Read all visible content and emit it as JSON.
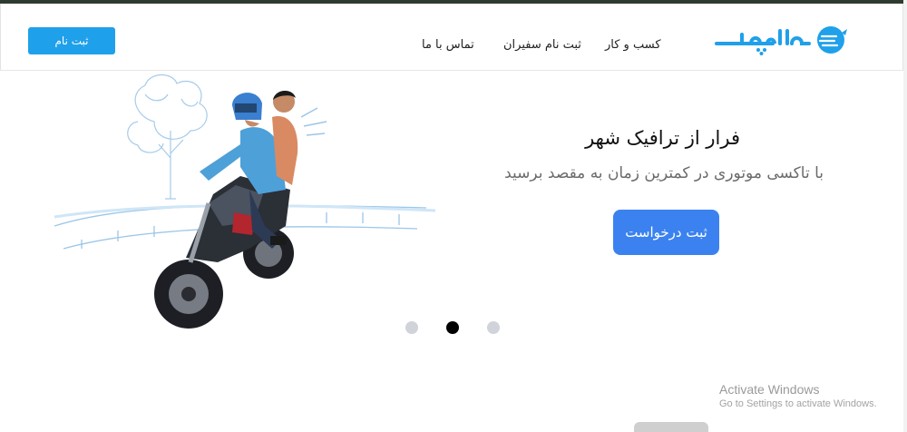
{
  "header": {
    "register_label": "ثبت نام",
    "nav": [
      "کسب و کار",
      "ثبت نام سفیران",
      "تماس با ما"
    ],
    "logo_text": "الوپیک"
  },
  "hero": {
    "title": "فرار از ترافیک شهر",
    "subtitle": "با تاکسی موتوری در کمترین زمان به مقصد برسید",
    "cta_label": "ثبت درخواست",
    "image": "motorcycle-taxi-illustration"
  },
  "carousel": {
    "slide_count": 3,
    "active_index": 1
  },
  "watermark": {
    "title": "Activate Windows",
    "subtitle": "Go to Settings to activate Windows."
  },
  "colors": {
    "brand": "#1fa0ea",
    "cta": "#3b82f0",
    "dot_inactive": "#d0d3da",
    "dot_active": "#000000"
  }
}
